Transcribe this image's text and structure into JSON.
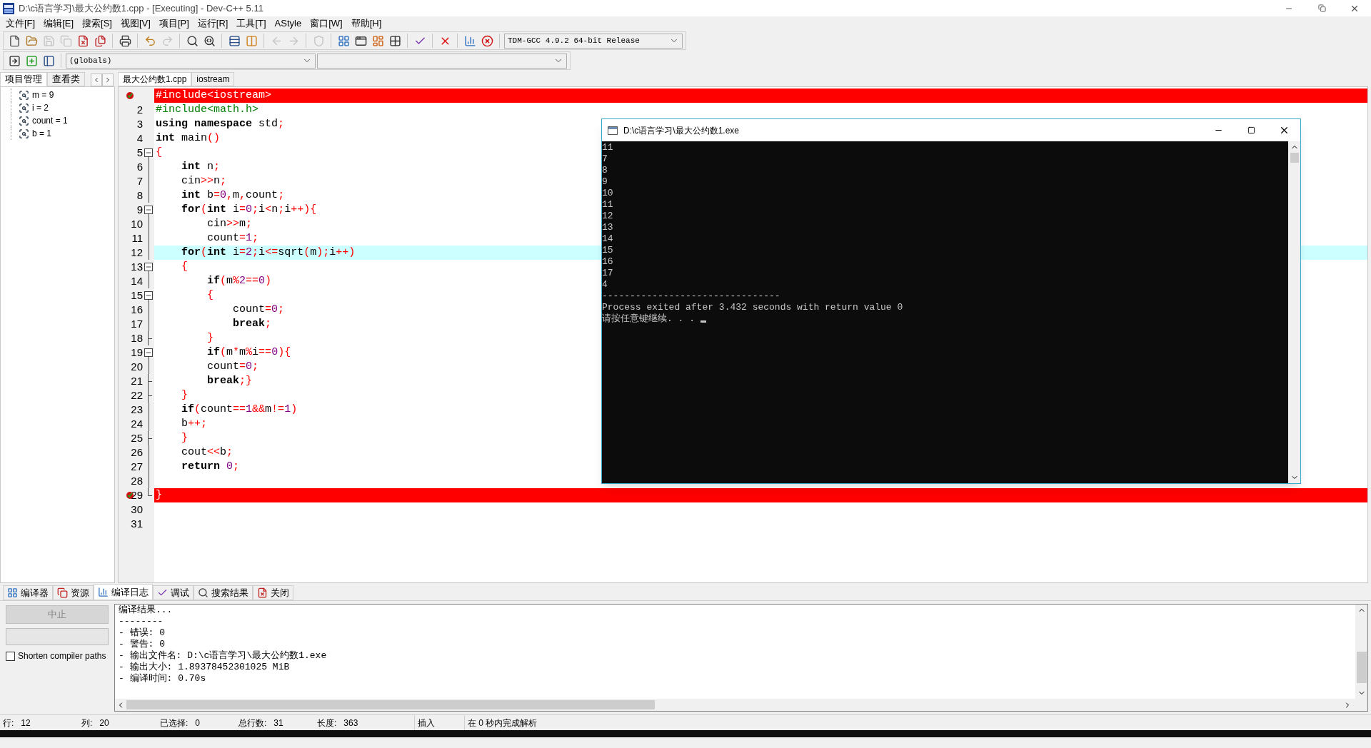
{
  "window": {
    "title": "D:\\c语言学习\\最大公约数1.cpp - [Executing] - Dev-C++ 5.11"
  },
  "menu": [
    "文件[F]",
    "编辑[E]",
    "搜索[S]",
    "视图[V]",
    "项目[P]",
    "运行[R]",
    "工具[T]",
    "AStyle",
    "窗口[W]",
    "帮助[H]"
  ],
  "toolbar": [
    {
      "kind": "new",
      "disabled": false
    },
    {
      "kind": "open",
      "disabled": false
    },
    {
      "kind": "save",
      "disabled": true
    },
    {
      "kind": "saveall",
      "disabled": true
    },
    {
      "kind": "close",
      "disabled": false
    },
    {
      "kind": "closeall",
      "disabled": false
    },
    {
      "kind": "sep"
    },
    {
      "kind": "print",
      "disabled": false
    },
    {
      "kind": "sep"
    },
    {
      "kind": "undo",
      "disabled": false
    },
    {
      "kind": "redo",
      "disabled": true
    },
    {
      "kind": "sep"
    },
    {
      "kind": "find",
      "disabled": false
    },
    {
      "kind": "replace",
      "disabled": false
    },
    {
      "kind": "sep"
    },
    {
      "kind": "rows",
      "disabled": false
    },
    {
      "kind": "columns",
      "disabled": false
    },
    {
      "kind": "sep"
    },
    {
      "kind": "back",
      "disabled": true
    },
    {
      "kind": "forward",
      "disabled": true
    },
    {
      "kind": "sep"
    },
    {
      "kind": "shield",
      "disabled": true
    },
    {
      "kind": "sep"
    },
    {
      "kind": "grid",
      "disabled": false
    },
    {
      "kind": "window",
      "disabled": false
    },
    {
      "kind": "dashboard",
      "disabled": false
    },
    {
      "kind": "grid2",
      "disabled": false
    },
    {
      "kind": "sep"
    },
    {
      "kind": "check",
      "disabled": false
    },
    {
      "kind": "sep"
    },
    {
      "kind": "stop",
      "disabled": false
    },
    {
      "kind": "sep"
    },
    {
      "kind": "chart",
      "disabled": false
    },
    {
      "kind": "chartx",
      "disabled": false
    }
  ],
  "compiler_select": {
    "value": "TDM-GCC 4.9.2 64-bit Release"
  },
  "toolbar2": [
    {
      "kind": "goto"
    },
    {
      "kind": "insert"
    },
    {
      "kind": "panel"
    }
  ],
  "scope_select": {
    "value": "(globals)"
  },
  "left_tabs": [
    {
      "label": "项目管理",
      "selected": true
    },
    {
      "label": "查看类",
      "selected": false
    }
  ],
  "watch_items": [
    {
      "label": "m = 9"
    },
    {
      "label": "i = 2"
    },
    {
      "label": "count = 1"
    },
    {
      "label": "b = 1"
    }
  ],
  "editor_tabs": [
    {
      "label": "最大公约数1.cpp",
      "selected": true
    },
    {
      "label": "iostream",
      "selected": false
    }
  ],
  "code_lines": [
    {
      "kind": "breakpoint",
      "tokens": [
        {
          "kind": "pre",
          "text": "#include<iostream>"
        }
      ]
    },
    {
      "kind": "plain",
      "number": "2",
      "tokens": [
        {
          "kind": "pre",
          "text": "#include<math.h>"
        }
      ]
    },
    {
      "kind": "plain",
      "number": "3",
      "tokens": [
        {
          "kind": "kw",
          "text": "using "
        },
        {
          "kind": "kw",
          "text": "namespace"
        },
        {
          "kind": "txt",
          "text": " std"
        },
        {
          "kind": "sym",
          "text": ";"
        }
      ]
    },
    {
      "kind": "plain",
      "number": "4",
      "tokens": [
        {
          "kind": "kw",
          "text": "int"
        },
        {
          "kind": "txt",
          "text": " main"
        },
        {
          "kind": "sym",
          "text": "()"
        }
      ]
    },
    {
      "kind": "plain",
      "number": "5",
      "fold_start": true,
      "tokens": [
        {
          "kind": "sym",
          "text": "{"
        }
      ]
    },
    {
      "kind": "plain",
      "number": "6",
      "tokens": [
        {
          "kind": "kw",
          "text": "    int"
        },
        {
          "kind": "txt",
          "text": " n"
        },
        {
          "kind": "sym",
          "text": ";"
        }
      ]
    },
    {
      "kind": "plain",
      "number": "7",
      "tokens": [
        {
          "kind": "txt",
          "text": "    cin"
        },
        {
          "kind": "sym",
          "text": ">>"
        },
        {
          "kind": "txt",
          "text": "n"
        },
        {
          "kind": "sym",
          "text": ";"
        }
      ]
    },
    {
      "kind": "plain",
      "number": "8",
      "tokens": [
        {
          "kind": "kw",
          "text": "    int"
        },
        {
          "kind": "txt",
          "text": " b"
        },
        {
          "kind": "sym",
          "text": "="
        },
        {
          "kind": "num",
          "text": "0"
        },
        {
          "kind": "sym",
          "text": ","
        },
        {
          "kind": "txt",
          "text": "m"
        },
        {
          "kind": "sym",
          "text": ","
        },
        {
          "kind": "txt",
          "text": "count"
        },
        {
          "kind": "sym",
          "text": ";"
        }
      ]
    },
    {
      "kind": "plain",
      "number": "9",
      "fold_start": true,
      "tokens": [
        {
          "kind": "kw",
          "text": "    for"
        },
        {
          "kind": "sym",
          "text": "("
        },
        {
          "kind": "kw",
          "text": "int"
        },
        {
          "kind": "txt",
          "text": " i"
        },
        {
          "kind": "sym",
          "text": "="
        },
        {
          "kind": "num",
          "text": "0"
        },
        {
          "kind": "sym",
          "text": ";"
        },
        {
          "kind": "txt",
          "text": "i"
        },
        {
          "kind": "sym",
          "text": "<"
        },
        {
          "kind": "txt",
          "text": "n"
        },
        {
          "kind": "sym",
          "text": ";"
        },
        {
          "kind": "txt",
          "text": "i"
        },
        {
          "kind": "sym",
          "text": "++){"
        }
      ]
    },
    {
      "kind": "plain",
      "number": "10",
      "tokens": [
        {
          "kind": "txt",
          "text": "        cin"
        },
        {
          "kind": "sym",
          "text": ">>"
        },
        {
          "kind": "txt",
          "text": "m"
        },
        {
          "kind": "sym",
          "text": ";"
        }
      ]
    },
    {
      "kind": "plain",
      "number": "11",
      "tokens": [
        {
          "kind": "txt",
          "text": "        count"
        },
        {
          "kind": "sym",
          "text": "="
        },
        {
          "kind": "num",
          "text": "1"
        },
        {
          "kind": "sym",
          "text": ";"
        }
      ]
    },
    {
      "kind": "current",
      "number": "12",
      "tokens": [
        {
          "kind": "kw",
          "text": "    for"
        },
        {
          "kind": "sym",
          "text": "("
        },
        {
          "kind": "kw",
          "text": "int"
        },
        {
          "kind": "txt",
          "text": " i"
        },
        {
          "kind": "sym",
          "text": "="
        },
        {
          "kind": "num",
          "text": "2"
        },
        {
          "kind": "sym",
          "text": ";"
        },
        {
          "kind": "txt",
          "text": "i"
        },
        {
          "kind": "sym",
          "text": "<="
        },
        {
          "kind": "txt",
          "text": "sqrt"
        },
        {
          "kind": "sym",
          "text": "("
        },
        {
          "kind": "txt",
          "text": "m"
        },
        {
          "kind": "sym",
          "text": ");"
        },
        {
          "kind": "txt",
          "text": "i"
        },
        {
          "kind": "sym",
          "text": "++)"
        }
      ]
    },
    {
      "kind": "plain",
      "number": "13",
      "fold_start": true,
      "tokens": [
        {
          "kind": "sym",
          "text": "    {"
        }
      ]
    },
    {
      "kind": "plain",
      "number": "14",
      "tokens": [
        {
          "kind": "kw",
          "text": "        if"
        },
        {
          "kind": "sym",
          "text": "("
        },
        {
          "kind": "txt",
          "text": "m"
        },
        {
          "kind": "sym",
          "text": "%"
        },
        {
          "kind": "num",
          "text": "2"
        },
        {
          "kind": "sym",
          "text": "=="
        },
        {
          "kind": "num",
          "text": "0"
        },
        {
          "kind": "sym",
          "text": ")"
        }
      ]
    },
    {
      "kind": "plain",
      "number": "15",
      "fold_start": true,
      "tokens": [
        {
          "kind": "sym",
          "text": "        {"
        }
      ]
    },
    {
      "kind": "plain",
      "number": "16",
      "tokens": [
        {
          "kind": "txt",
          "text": "            count"
        },
        {
          "kind": "sym",
          "text": "="
        },
        {
          "kind": "num",
          "text": "0"
        },
        {
          "kind": "sym",
          "text": ";"
        }
      ]
    },
    {
      "kind": "plain",
      "number": "17",
      "tokens": [
        {
          "kind": "kw",
          "text": "            break"
        },
        {
          "kind": "sym",
          "text": ";"
        }
      ]
    },
    {
      "kind": "plain",
      "number": "18",
      "fold_end": true,
      "tokens": [
        {
          "kind": "sym",
          "text": "        }"
        }
      ]
    },
    {
      "kind": "plain",
      "number": "19",
      "fold_start": true,
      "tokens": [
        {
          "kind": "kw",
          "text": "        if"
        },
        {
          "kind": "sym",
          "text": "("
        },
        {
          "kind": "txt",
          "text": "m"
        },
        {
          "kind": "sym",
          "text": "*"
        },
        {
          "kind": "txt",
          "text": "m"
        },
        {
          "kind": "sym",
          "text": "%"
        },
        {
          "kind": "txt",
          "text": "i"
        },
        {
          "kind": "sym",
          "text": "=="
        },
        {
          "kind": "num",
          "text": "0"
        },
        {
          "kind": "sym",
          "text": "){"
        }
      ]
    },
    {
      "kind": "plain",
      "number": "20",
      "tokens": [
        {
          "kind": "txt",
          "text": "        count"
        },
        {
          "kind": "sym",
          "text": "="
        },
        {
          "kind": "num",
          "text": "0"
        },
        {
          "kind": "sym",
          "text": ";"
        }
      ]
    },
    {
      "kind": "plain",
      "number": "21",
      "fold_end": true,
      "tokens": [
        {
          "kind": "kw",
          "text": "        break"
        },
        {
          "kind": "sym",
          "text": ";}"
        }
      ]
    },
    {
      "kind": "plain",
      "number": "22",
      "fold_end": true,
      "tokens": [
        {
          "kind": "sym",
          "text": "    }"
        }
      ]
    },
    {
      "kind": "plain",
      "number": "23",
      "tokens": [
        {
          "kind": "kw",
          "text": "    if"
        },
        {
          "kind": "sym",
          "text": "("
        },
        {
          "kind": "txt",
          "text": "count"
        },
        {
          "kind": "sym",
          "text": "=="
        },
        {
          "kind": "num",
          "text": "1"
        },
        {
          "kind": "sym",
          "text": "&&"
        },
        {
          "kind": "txt",
          "text": "m"
        },
        {
          "kind": "sym",
          "text": "!="
        },
        {
          "kind": "num",
          "text": "1"
        },
        {
          "kind": "sym",
          "text": ")"
        }
      ]
    },
    {
      "kind": "plain",
      "number": "24",
      "tokens": [
        {
          "kind": "txt",
          "text": "    b"
        },
        {
          "kind": "sym",
          "text": "++;"
        }
      ]
    },
    {
      "kind": "plain",
      "number": "25",
      "fold_end": true,
      "tokens": [
        {
          "kind": "sym",
          "text": "    }"
        }
      ]
    },
    {
      "kind": "plain",
      "number": "26",
      "tokens": [
        {
          "kind": "txt",
          "text": "    cout"
        },
        {
          "kind": "sym",
          "text": "<<"
        },
        {
          "kind": "txt",
          "text": "b"
        },
        {
          "kind": "sym",
          "text": ";"
        }
      ]
    },
    {
      "kind": "plain",
      "number": "27",
      "tokens": [
        {
          "kind": "kw",
          "text": "    return"
        },
        {
          "kind": "num",
          "text": " 0"
        },
        {
          "kind": "sym",
          "text": ";"
        }
      ]
    },
    {
      "kind": "plain",
      "number": "28"
    },
    {
      "kind": "breakpoint",
      "number": "29",
      "fold_end": true,
      "tokens": [
        {
          "kind": "sym",
          "text": "}"
        }
      ]
    },
    {
      "kind": "plain",
      "number": "30"
    },
    {
      "kind": "plain",
      "number": "31"
    }
  ],
  "console": {
    "title": "D:\\c语言学习\\最大公约数1.exe",
    "lines": [
      "11",
      "7",
      "8",
      "9",
      "10",
      "11",
      "12",
      "13",
      "14",
      "15",
      "16",
      "17",
      "4",
      "--------------------------------",
      "Process exited after 3.432 seconds with return value 0",
      "请按任意键继续. . ."
    ]
  },
  "bottom_tabs": [
    {
      "label": "编译器",
      "kind": "grid",
      "selected": false
    },
    {
      "label": "资源",
      "kind": "copy",
      "selected": false
    },
    {
      "label": "编译日志",
      "kind": "chart",
      "selected": true
    },
    {
      "label": "调试",
      "kind": "check",
      "selected": false
    },
    {
      "label": "搜索结果",
      "kind": "search",
      "selected": false
    },
    {
      "label": "关闭",
      "kind": "close",
      "selected": false
    }
  ],
  "abort_button": {
    "label": "中止",
    "disabled": true
  },
  "shorten_paths": {
    "label": "Shorten compiler paths",
    "checked": false
  },
  "log_lines": [
    "编译结果...",
    "--------",
    "- 错误: 0",
    "- 警告: 0",
    "- 输出文件名: D:\\c语言学习\\最大公约数1.exe",
    "- 输出大小: 1.89378452301025 MiB",
    "- 编译时间: 0.70s"
  ],
  "status_bar": [
    {
      "label": "行:",
      "value": "12"
    },
    {
      "label": "列:",
      "value": "20"
    },
    {
      "label": "已选择:",
      "value": "0"
    },
    {
      "label": "总行数:",
      "value": "31"
    },
    {
      "label": "长度:",
      "value": "363"
    },
    {
      "value": "插入"
    },
    {
      "value": "在 0 秒内完成解析"
    }
  ]
}
